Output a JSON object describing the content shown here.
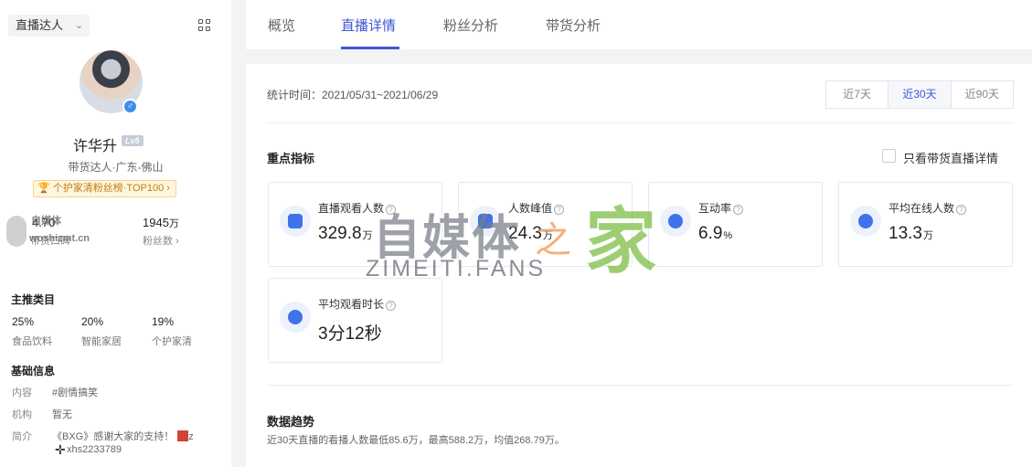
{
  "sidebar": {
    "mode_select": "直播达人",
    "profile": {
      "name": "许华升",
      "level": "Lv5",
      "subtitle": "带货达人·广东-佛山",
      "rank_badge": "个护家清粉丝榜·TOP100"
    },
    "stats": [
      {
        "value": "4.70",
        "unit": "",
        "label": "带货口碑"
      },
      {
        "value": "1945",
        "unit": "万",
        "label": "粉丝数 ›"
      }
    ],
    "main_categories": {
      "title": "主推类目",
      "items": [
        {
          "pct": "25%",
          "name": "食品饮料"
        },
        {
          "pct": "20%",
          "name": "智能家居"
        },
        {
          "pct": "19%",
          "name": "个护家清"
        }
      ]
    },
    "basic_info": {
      "title": "基础信息",
      "rows": [
        {
          "key": "内容",
          "value": "#剧情搞笑"
        },
        {
          "key": "机构",
          "value": "暂无"
        },
        {
          "key": "简介",
          "value": "《BXG》感谢大家的支持！",
          "value_extra": "z",
          "value_line2": "xhs2233789"
        }
      ]
    }
  },
  "tabs": [
    "概览",
    "直播详情",
    "粉丝分析",
    "带货分析"
  ],
  "active_tab": 1,
  "main": {
    "stat_time_label": "统计时间：2021/05/31~2021/06/29",
    "ranges": [
      "近7天",
      "近30天",
      "近90天"
    ],
    "active_range": 1,
    "key_metrics_title": "重点指标",
    "only_sales_label": "只看带货直播详情",
    "metrics": [
      {
        "title": "直播观看人数",
        "value": "329.8",
        "unit": "万",
        "icon": "video-camera-icon"
      },
      {
        "title": "人数峰值",
        "value": "24.3",
        "unit": "万",
        "icon": "peak-chart-icon"
      },
      {
        "title": "互动率",
        "value": "6.9",
        "unit": "%",
        "icon": "chat-bubble-icon"
      },
      {
        "title": "平均在线人数",
        "value": "13.3",
        "unit": "万",
        "icon": "online-user-icon"
      },
      {
        "title": "平均观看时长",
        "value": "3分12秒",
        "unit": "",
        "icon": "clock-icon"
      }
    ],
    "trend_title": "数据趋势",
    "trend_desc": "近30天直播的看播人数最低85.6万，最高588.2万，均值268.79万。"
  },
  "watermark": {
    "cn": "自媒体",
    "zhi": "之",
    "jia": "家",
    "url": "ZIMEITI.FANS",
    "small_line1": "自媒体",
    "small_line2": "woshizmt.cn"
  }
}
